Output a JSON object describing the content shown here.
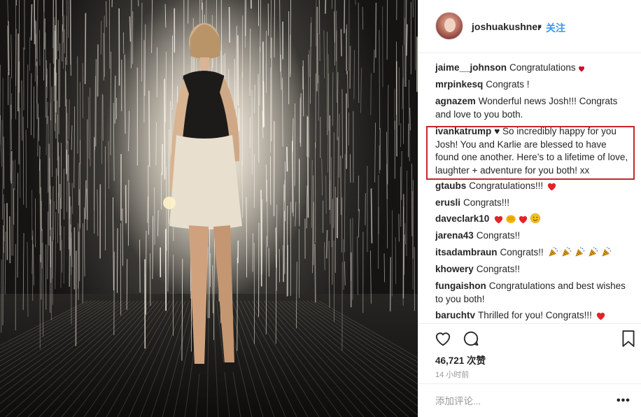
{
  "post": {
    "photo_alt": "",
    "header": {
      "username": "joshuakushner",
      "separator": "•",
      "follow_label": "关注",
      "avatar_icon": "profile-avatar"
    },
    "comments": [
      {
        "user": "jaime__johnson",
        "text": "Congratulations",
        "emojis": [
          "heart-icon"
        ]
      },
      {
        "user": "mrpinkesq",
        "text": "Congrats !",
        "emojis": []
      },
      {
        "user": "agnazem",
        "text": "Wonderful news Josh!!! Congrats and love to you both.",
        "emojis": []
      },
      {
        "user": "ivankatrump",
        "text": "♥ So incredibly happy for you Josh! You and Karlie are blessed to have found one another. Here’s to a lifetime of love, laughter + adventure for you both! xx",
        "emojis": [],
        "highlighted": true
      },
      {
        "user": "gtaubs",
        "text": "Congratulations!!!",
        "emojis": [
          "heart-icon"
        ]
      },
      {
        "user": "erusli",
        "text": "Congrats!!!",
        "emojis": []
      },
      {
        "user": "daveclark10",
        "text": "",
        "emojis": [
          "heart-icon",
          "fist-icon",
          "heart-icon",
          "smiley-icon"
        ]
      },
      {
        "user": "jarena43",
        "text": "Congrats!!",
        "emojis": []
      },
      {
        "user": "itsadambraun",
        "text": "Congrats!!",
        "emojis": [
          "party-popper-icon",
          "party-popper-icon",
          "party-popper-icon",
          "party-popper-icon",
          "party-popper-icon"
        ]
      },
      {
        "user": "khowery",
        "text": "Congrats!!",
        "emojis": []
      },
      {
        "user": "fungaishon",
        "text": "Congratulations and best wishes to you both!",
        "emojis": []
      },
      {
        "user": "baruchtv",
        "text": "Thrilled for you! Congrats!!!",
        "emojis": [
          "heart-icon"
        ]
      }
    ],
    "likes": "46,721 次赞",
    "timestamp": "14 小时前",
    "add_comment_placeholder": "添加评论...",
    "more_label": "•••",
    "icons": [
      "heart-outline-icon",
      "comment-icon",
      "bookmark-icon"
    ],
    "colors": {
      "follow": "#3897f0",
      "highlight_border": "#c8262c",
      "heart": "#e0242c",
      "text": "#262626",
      "muted": "#999999"
    }
  }
}
